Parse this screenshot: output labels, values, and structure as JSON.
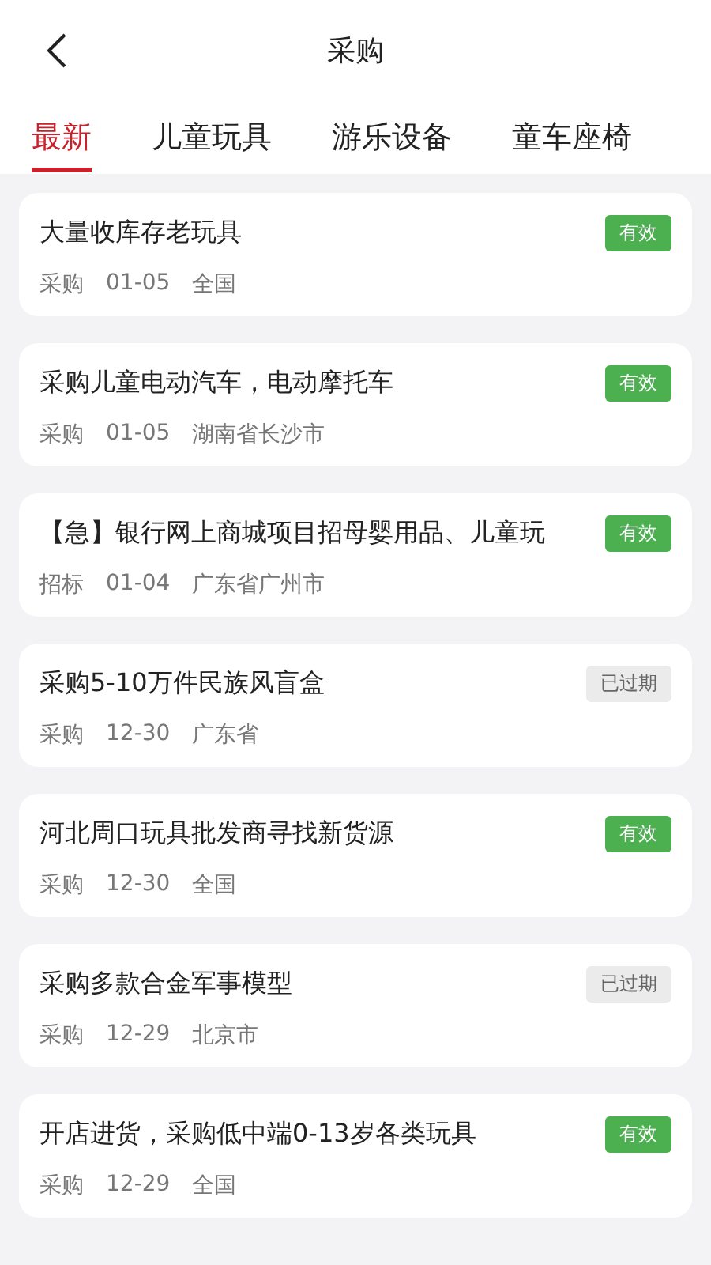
{
  "header": {
    "title": "采购"
  },
  "tabs": [
    {
      "label": "最新",
      "selected": true
    },
    {
      "label": "儿童玩具",
      "selected": false
    },
    {
      "label": "游乐设备",
      "selected": false
    },
    {
      "label": "童车座椅",
      "selected": false
    }
  ],
  "items": [
    {
      "title": "大量收库存老玩具",
      "type": "采购",
      "date": "01-05",
      "region": "全国",
      "status": {
        "label": "有效",
        "kind": "valid"
      }
    },
    {
      "title": "采购儿童电动汽车，电动摩托车",
      "type": "采购",
      "date": "01-05",
      "region": "湖南省长沙市",
      "status": {
        "label": "有效",
        "kind": "valid"
      }
    },
    {
      "title": "【急】银行网上商城项目招母婴用品、儿童玩",
      "type": "招标",
      "date": "01-04",
      "region": "广东省广州市",
      "status": {
        "label": "有效",
        "kind": "valid"
      }
    },
    {
      "title": "采购5-10万件民族风盲盒",
      "type": "采购",
      "date": "12-30",
      "region": "广东省",
      "status": {
        "label": "已过期",
        "kind": "expired"
      }
    },
    {
      "title": "河北周口玩具批发商寻找新货源",
      "type": "采购",
      "date": "12-30",
      "region": "全国",
      "status": {
        "label": "有效",
        "kind": "valid"
      }
    },
    {
      "title": "采购多款合金军事模型",
      "type": "采购",
      "date": "12-29",
      "region": "北京市",
      "status": {
        "label": "已过期",
        "kind": "expired"
      }
    },
    {
      "title": "开店进货，采购低中端0-13岁各类玩具",
      "type": "采购",
      "date": "12-29",
      "region": "全国",
      "status": {
        "label": "有效",
        "kind": "valid"
      }
    }
  ]
}
